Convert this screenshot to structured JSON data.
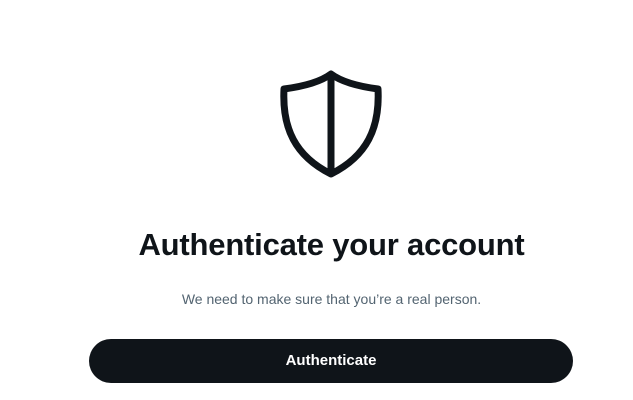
{
  "icon": "shield-icon",
  "colors": {
    "text_primary": "#0f1419",
    "text_secondary": "#536471",
    "button_bg": "#0f1419",
    "button_text": "#ffffff"
  },
  "main": {
    "title": "Authenticate your account",
    "subtitle": "We need to make sure that you’re a real person.",
    "button_label": "Authenticate"
  }
}
